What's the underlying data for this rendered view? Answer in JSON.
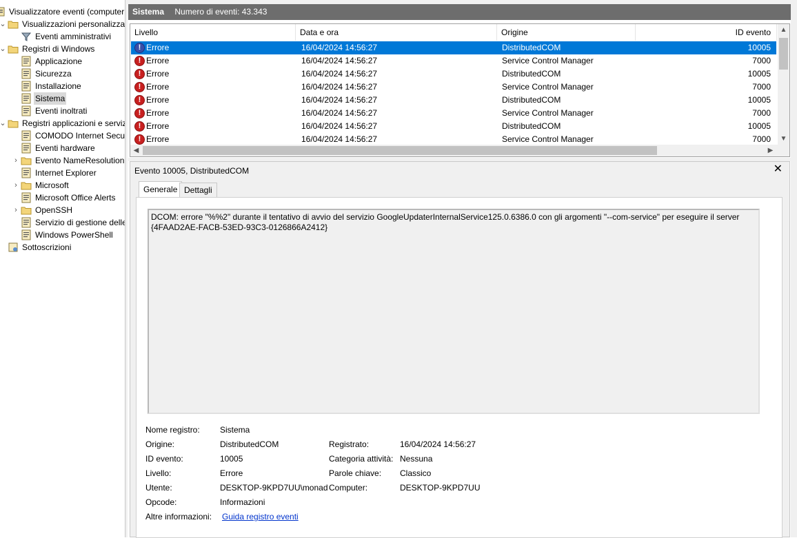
{
  "tree": {
    "items": [
      {
        "label": "Visualizzatore eventi (computer",
        "icon": "event-viewer-icon"
      },
      {
        "label": "Visualizzazioni personalizzate",
        "icon": "folder-icon"
      },
      {
        "label": "Eventi amministrativi",
        "icon": "filter-icon"
      },
      {
        "label": "Registri di Windows",
        "icon": "folder-icon"
      },
      {
        "label": "Applicazione",
        "icon": "log-icon"
      },
      {
        "label": "Sicurezza",
        "icon": "log-icon"
      },
      {
        "label": "Installazione",
        "icon": "log-icon"
      },
      {
        "label": "Sistema",
        "icon": "log-icon"
      },
      {
        "label": "Eventi inoltrati",
        "icon": "log-icon"
      },
      {
        "label": "Registri applicazioni e servizi",
        "icon": "folder-icon"
      },
      {
        "label": "COMODO Internet Secur",
        "icon": "log-icon"
      },
      {
        "label": "Eventi hardware",
        "icon": "log-icon"
      },
      {
        "label": "Evento NameResolution",
        "icon": "folder-icon"
      },
      {
        "label": "Internet Explorer",
        "icon": "log-icon"
      },
      {
        "label": "Microsoft",
        "icon": "folder-icon"
      },
      {
        "label": "Microsoft Office Alerts",
        "icon": "log-icon"
      },
      {
        "label": "OpenSSH",
        "icon": "folder-icon"
      },
      {
        "label": "Servizio di gestione delle",
        "icon": "log-icon"
      },
      {
        "label": "Windows PowerShell",
        "icon": "log-icon"
      },
      {
        "label": "Sottoscrizioni",
        "icon": "subscription-icon"
      }
    ]
  },
  "header": {
    "title": "Sistema",
    "count": "Numero di eventi: 43.343"
  },
  "grid": {
    "columns": [
      "Livello",
      "Data e ora",
      "Origine",
      "ID evento"
    ],
    "rows": [
      {
        "level": "Errore",
        "date": "16/04/2024 14:56:27",
        "source": "DistributedCOM",
        "id": "10005"
      },
      {
        "level": "Errore",
        "date": "16/04/2024 14:56:27",
        "source": "Service Control Manager",
        "id": "7000"
      },
      {
        "level": "Errore",
        "date": "16/04/2024 14:56:27",
        "source": "DistributedCOM",
        "id": "10005"
      },
      {
        "level": "Errore",
        "date": "16/04/2024 14:56:27",
        "source": "Service Control Manager",
        "id": "7000"
      },
      {
        "level": "Errore",
        "date": "16/04/2024 14:56:27",
        "source": "DistributedCOM",
        "id": "10005"
      },
      {
        "level": "Errore",
        "date": "16/04/2024 14:56:27",
        "source": "Service Control Manager",
        "id": "7000"
      },
      {
        "level": "Errore",
        "date": "16/04/2024 14:56:27",
        "source": "DistributedCOM",
        "id": "10005"
      },
      {
        "level": "Errore",
        "date": "16/04/2024 14:56:27",
        "source": "Service Control Manager",
        "id": "7000"
      }
    ]
  },
  "detail": {
    "title": "Evento 10005, DistributedCOM",
    "close": "✕",
    "tabs": [
      "Generale",
      "Dettagli"
    ],
    "message": "DCOM: errore \"%%2\" durante il tentativo di avvio del servizio GoogleUpdaterInternalService125.0.6386.0 con gli argomenti \"--com-service\" per eseguire il server\n{4FAAD2AE-FACB-53ED-93C3-0126866A2412}",
    "props": {
      "nome_registro_label": "Nome registro:",
      "nome_registro": "Sistema",
      "origine_label": "Origine:",
      "origine": "DistributedCOM",
      "id_label": "ID evento:",
      "id": "10005",
      "livello_label": "Livello:",
      "livello": "Errore",
      "utente_label": "Utente:",
      "utente": "DESKTOP-9KPD7UU\\monad",
      "opcode_label": "Opcode:",
      "opcode": "Informazioni",
      "altre_label": "Altre informazioni:",
      "altre_link": "Guida registro eventi",
      "registrato_label": "Registrato:",
      "registrato": "16/04/2024 14:56:27",
      "categoria_label": "Categoria attività:",
      "categoria": "Nessuna",
      "parole_label": "Parole chiave:",
      "parole": "Classico",
      "computer_label": "Computer:",
      "computer": "DESKTOP-9KPD7UU"
    }
  }
}
